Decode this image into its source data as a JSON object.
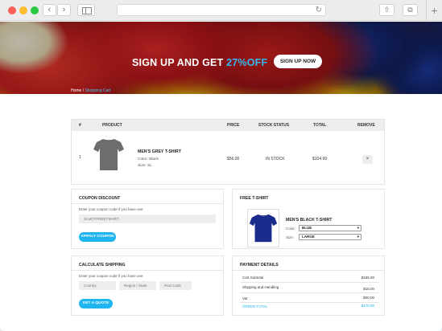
{
  "hero": {
    "title_main": "SIGN UP AND GET ",
    "title_accent": "27%OFF",
    "button_label": "SIGN UP NOW",
    "breadcrumb_home": "Home",
    "breadcrumb_sep": " / ",
    "breadcrumb_current": "Shopping Cart"
  },
  "cart": {
    "columns": [
      "#",
      "PRODUCT",
      "PRICE",
      "STOCK STATUS",
      "TOTAL",
      "REMOVE"
    ],
    "rows": [
      {
        "index": "1",
        "name": "MEN'S GREY T-SHIRT",
        "color": "Color: Black",
        "size": "Size: SL",
        "price": "$56.00",
        "stock": "IN STOCK",
        "total": "$104.99",
        "remove_label": "×"
      }
    ]
  },
  "coupon": {
    "title": "COUPON DISCOUNT",
    "hint": "Enter your coupon code if you have one",
    "input_value": "XLMOTFREETSHIRT",
    "button_label": "APPALY COUPON"
  },
  "free_tshirt": {
    "title": "FREE T-SHIRT",
    "name": "MEN'S BLACK T-SHIRT",
    "color_label": "Color:",
    "color_value": "BLUE",
    "size_label": "Size:",
    "size_value": "LARGE"
  },
  "shipping": {
    "title": "CALCULATE SHIPPING",
    "hint": "Enter your coupon code if you have one",
    "country_placeholder": "Country",
    "region_placeholder": "Region / State",
    "postcode_placeholder": "Post Code",
    "button_label": "GET A QUOTE"
  },
  "payment": {
    "title": "PAYMENT DETAILS",
    "rows": [
      {
        "label": "Cart Subtotal",
        "value": "$155.00"
      },
      {
        "label": "Shipping and Handling",
        "value": "$15.00"
      },
      {
        "label": "Vat",
        "value": "$00.00"
      },
      {
        "label": "ORDER TOTAL",
        "value": "$170.00"
      }
    ]
  },
  "colors": {
    "accent": "#1fb5ee",
    "header_bg": "#ededed"
  }
}
